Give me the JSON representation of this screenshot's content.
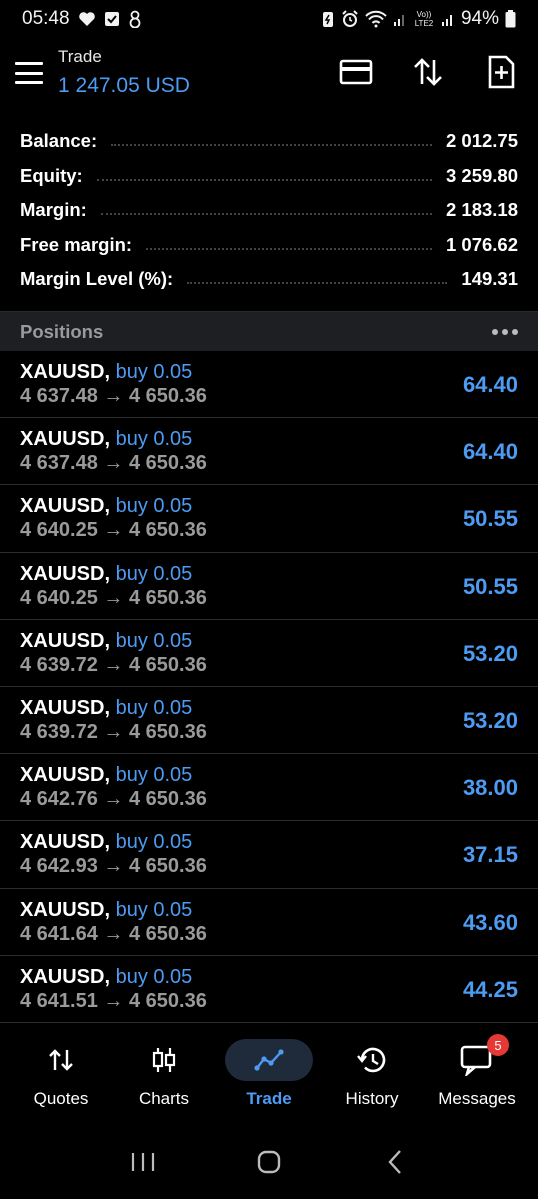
{
  "status_bar": {
    "time": "05:48",
    "battery": "94%",
    "network_label": "Vo)) LTE2"
  },
  "app_bar": {
    "title": "Trade",
    "subtitle": "1 247.05 USD"
  },
  "summary": [
    {
      "label": "Balance:",
      "value": "2 012.75"
    },
    {
      "label": "Equity:",
      "value": "3 259.80"
    },
    {
      "label": "Margin:",
      "value": "2 183.18"
    },
    {
      "label": "Free margin:",
      "value": "1 076.62"
    },
    {
      "label": "Margin Level (%):",
      "value": "149.31"
    }
  ],
  "positions_header": "Positions",
  "positions": [
    {
      "symbol": "XAUUSD,",
      "side": "buy 0.05",
      "prices": "4 637.48 → 4 650.36",
      "profit": "64.40"
    },
    {
      "symbol": "XAUUSD,",
      "side": "buy 0.05",
      "prices": "4 637.48 → 4 650.36",
      "profit": "64.40"
    },
    {
      "symbol": "XAUUSD,",
      "side": "buy 0.05",
      "prices": "4 640.25 → 4 650.36",
      "profit": "50.55"
    },
    {
      "symbol": "XAUUSD,",
      "side": "buy 0.05",
      "prices": "4 640.25 → 4 650.36",
      "profit": "50.55"
    },
    {
      "symbol": "XAUUSD,",
      "side": "buy 0.05",
      "prices": "4 639.72 → 4 650.36",
      "profit": "53.20"
    },
    {
      "symbol": "XAUUSD,",
      "side": "buy 0.05",
      "prices": "4 639.72 → 4 650.36",
      "profit": "53.20"
    },
    {
      "symbol": "XAUUSD,",
      "side": "buy 0.05",
      "prices": "4 642.76 → 4 650.36",
      "profit": "38.00"
    },
    {
      "symbol": "XAUUSD,",
      "side": "buy 0.05",
      "prices": "4 642.93 → 4 650.36",
      "profit": "37.15"
    },
    {
      "symbol": "XAUUSD,",
      "side": "buy 0.05",
      "prices": "4 641.64 → 4 650.36",
      "profit": "43.60"
    },
    {
      "symbol": "XAUUSD,",
      "side": "buy 0.05",
      "prices": "4 641.51 → 4 650.36",
      "profit": "44.25"
    }
  ],
  "bottom_nav": {
    "quotes": "Quotes",
    "charts": "Charts",
    "trade": "Trade",
    "history": "History",
    "messages": "Messages",
    "messages_badge": "5"
  },
  "colors": {
    "accent": "#4d9bf2",
    "background": "#000000",
    "header_bg": "#1e1f22",
    "secondary_text": "#9a9a9a",
    "badge": "#e53935"
  },
  "icons": {
    "menu": "hamburger-icon",
    "toolbar": [
      "card-icon",
      "sort-arrows-icon",
      "new-order-icon"
    ],
    "nav": [
      "quotes-arrows-icon",
      "candlestick-icon",
      "trade-line-icon",
      "history-clock-icon",
      "chat-icon"
    ]
  }
}
